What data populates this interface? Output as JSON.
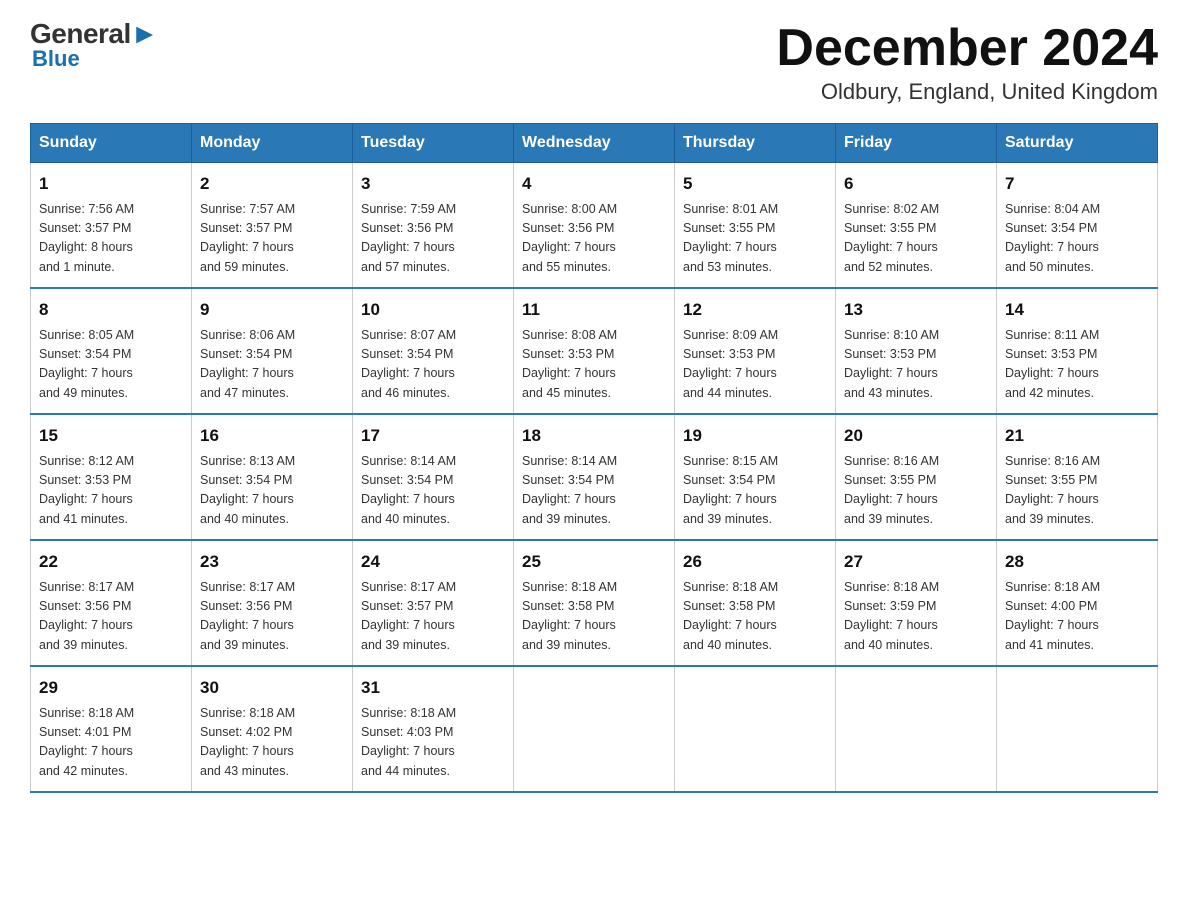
{
  "header": {
    "logo_general": "General",
    "logo_blue": "Blue",
    "month_title": "December 2024",
    "location": "Oldbury, England, United Kingdom"
  },
  "days_of_week": [
    "Sunday",
    "Monday",
    "Tuesday",
    "Wednesday",
    "Thursday",
    "Friday",
    "Saturday"
  ],
  "weeks": [
    [
      {
        "day": "1",
        "sunrise": "7:56 AM",
        "sunset": "3:57 PM",
        "daylight": "8 hours and 1 minute."
      },
      {
        "day": "2",
        "sunrise": "7:57 AM",
        "sunset": "3:57 PM",
        "daylight": "7 hours and 59 minutes."
      },
      {
        "day": "3",
        "sunrise": "7:59 AM",
        "sunset": "3:56 PM",
        "daylight": "7 hours and 57 minutes."
      },
      {
        "day": "4",
        "sunrise": "8:00 AM",
        "sunset": "3:56 PM",
        "daylight": "7 hours and 55 minutes."
      },
      {
        "day": "5",
        "sunrise": "8:01 AM",
        "sunset": "3:55 PM",
        "daylight": "7 hours and 53 minutes."
      },
      {
        "day": "6",
        "sunrise": "8:02 AM",
        "sunset": "3:55 PM",
        "daylight": "7 hours and 52 minutes."
      },
      {
        "day": "7",
        "sunrise": "8:04 AM",
        "sunset": "3:54 PM",
        "daylight": "7 hours and 50 minutes."
      }
    ],
    [
      {
        "day": "8",
        "sunrise": "8:05 AM",
        "sunset": "3:54 PM",
        "daylight": "7 hours and 49 minutes."
      },
      {
        "day": "9",
        "sunrise": "8:06 AM",
        "sunset": "3:54 PM",
        "daylight": "7 hours and 47 minutes."
      },
      {
        "day": "10",
        "sunrise": "8:07 AM",
        "sunset": "3:54 PM",
        "daylight": "7 hours and 46 minutes."
      },
      {
        "day": "11",
        "sunrise": "8:08 AM",
        "sunset": "3:53 PM",
        "daylight": "7 hours and 45 minutes."
      },
      {
        "day": "12",
        "sunrise": "8:09 AM",
        "sunset": "3:53 PM",
        "daylight": "7 hours and 44 minutes."
      },
      {
        "day": "13",
        "sunrise": "8:10 AM",
        "sunset": "3:53 PM",
        "daylight": "7 hours and 43 minutes."
      },
      {
        "day": "14",
        "sunrise": "8:11 AM",
        "sunset": "3:53 PM",
        "daylight": "7 hours and 42 minutes."
      }
    ],
    [
      {
        "day": "15",
        "sunrise": "8:12 AM",
        "sunset": "3:53 PM",
        "daylight": "7 hours and 41 minutes."
      },
      {
        "day": "16",
        "sunrise": "8:13 AM",
        "sunset": "3:54 PM",
        "daylight": "7 hours and 40 minutes."
      },
      {
        "day": "17",
        "sunrise": "8:14 AM",
        "sunset": "3:54 PM",
        "daylight": "7 hours and 40 minutes."
      },
      {
        "day": "18",
        "sunrise": "8:14 AM",
        "sunset": "3:54 PM",
        "daylight": "7 hours and 39 minutes."
      },
      {
        "day": "19",
        "sunrise": "8:15 AM",
        "sunset": "3:54 PM",
        "daylight": "7 hours and 39 minutes."
      },
      {
        "day": "20",
        "sunrise": "8:16 AM",
        "sunset": "3:55 PM",
        "daylight": "7 hours and 39 minutes."
      },
      {
        "day": "21",
        "sunrise": "8:16 AM",
        "sunset": "3:55 PM",
        "daylight": "7 hours and 39 minutes."
      }
    ],
    [
      {
        "day": "22",
        "sunrise": "8:17 AM",
        "sunset": "3:56 PM",
        "daylight": "7 hours and 39 minutes."
      },
      {
        "day": "23",
        "sunrise": "8:17 AM",
        "sunset": "3:56 PM",
        "daylight": "7 hours and 39 minutes."
      },
      {
        "day": "24",
        "sunrise": "8:17 AM",
        "sunset": "3:57 PM",
        "daylight": "7 hours and 39 minutes."
      },
      {
        "day": "25",
        "sunrise": "8:18 AM",
        "sunset": "3:58 PM",
        "daylight": "7 hours and 39 minutes."
      },
      {
        "day": "26",
        "sunrise": "8:18 AM",
        "sunset": "3:58 PM",
        "daylight": "7 hours and 40 minutes."
      },
      {
        "day": "27",
        "sunrise": "8:18 AM",
        "sunset": "3:59 PM",
        "daylight": "7 hours and 40 minutes."
      },
      {
        "day": "28",
        "sunrise": "8:18 AM",
        "sunset": "4:00 PM",
        "daylight": "7 hours and 41 minutes."
      }
    ],
    [
      {
        "day": "29",
        "sunrise": "8:18 AM",
        "sunset": "4:01 PM",
        "daylight": "7 hours and 42 minutes."
      },
      {
        "day": "30",
        "sunrise": "8:18 AM",
        "sunset": "4:02 PM",
        "daylight": "7 hours and 43 minutes."
      },
      {
        "day": "31",
        "sunrise": "8:18 AM",
        "sunset": "4:03 PM",
        "daylight": "7 hours and 44 minutes."
      },
      null,
      null,
      null,
      null
    ]
  ],
  "labels": {
    "sunrise": "Sunrise:",
    "sunset": "Sunset:",
    "daylight": "Daylight:"
  }
}
